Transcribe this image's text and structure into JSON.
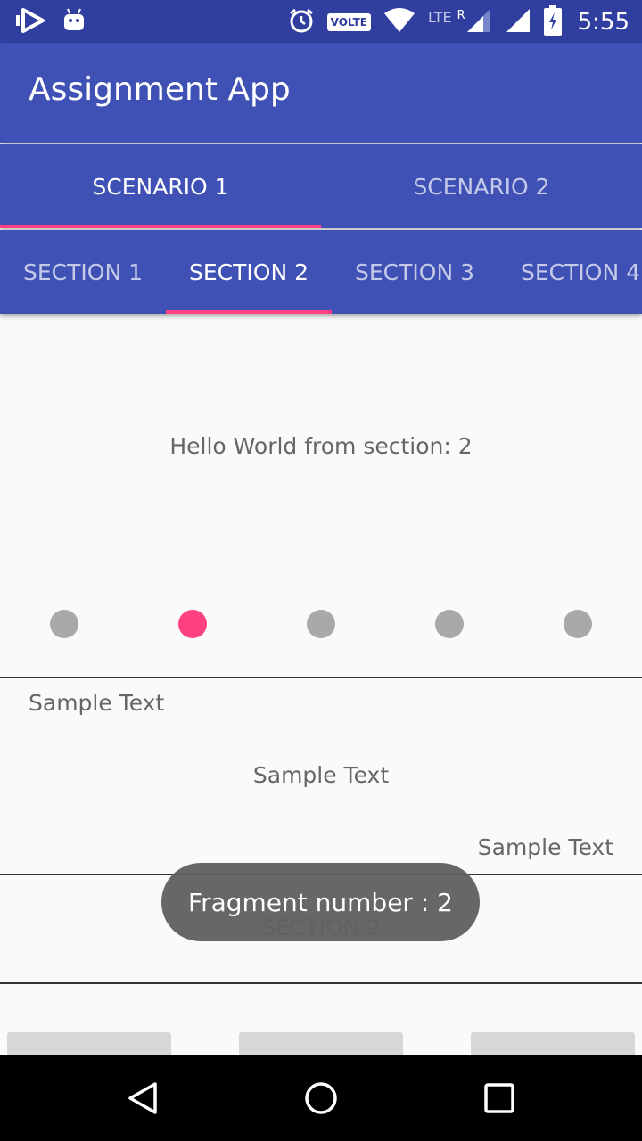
{
  "status_bar": {
    "time": "5:55",
    "volte": "VOLTE",
    "lte": "LTE",
    "roaming": "R",
    "icons": [
      "play-icon",
      "android-icon",
      "alarm-icon",
      "wifi-icon",
      "signal-icon",
      "battery-icon"
    ]
  },
  "app_bar": {
    "title": "Assignment App"
  },
  "tabs_top": [
    {
      "label": "SCENARIO 1",
      "active": true
    },
    {
      "label": "SCENARIO 2",
      "active": false
    }
  ],
  "tabs_sub": [
    {
      "label": "SECTION 1",
      "active": false
    },
    {
      "label": "SECTION 2",
      "active": true
    },
    {
      "label": "SECTION 3",
      "active": false
    },
    {
      "label": "SECTION 4",
      "active": false
    }
  ],
  "content": {
    "hello": "Hello World from section: 2",
    "page_indicator": {
      "count": 5,
      "active_index": 1
    },
    "sample_texts": [
      "Sample Text",
      "Sample Text",
      "Sample Text"
    ],
    "section_label": "SECTION 2"
  },
  "toast": {
    "text": "Fragment number : 2"
  },
  "colors": {
    "primary": "#3f51b5",
    "primary_dark": "#303f9f",
    "accent": "#ff4081",
    "indicator_inactive": "#a9a9a9"
  },
  "nav_bar": {
    "icons": [
      "back-icon",
      "home-icon",
      "recents-icon"
    ]
  }
}
